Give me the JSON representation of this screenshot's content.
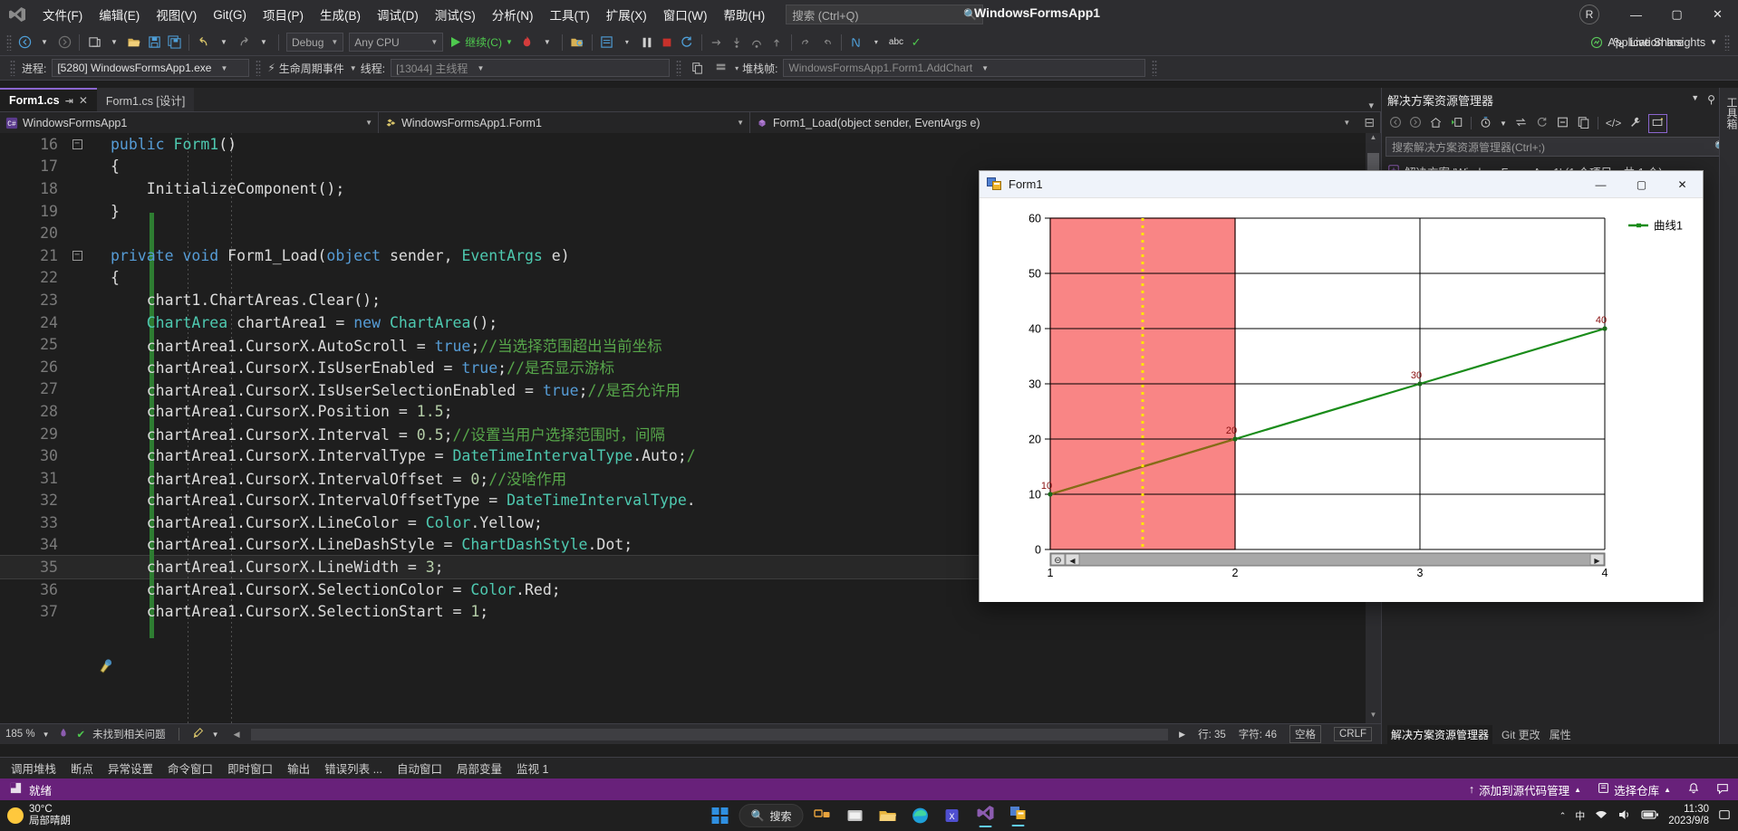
{
  "window": {
    "title": "WindowsFormsApp1",
    "account_initial": "R"
  },
  "menubar": {
    "logo": "vs-logo-icon",
    "items": [
      "文件(F)",
      "编辑(E)",
      "视图(V)",
      "Git(G)",
      "项目(P)",
      "生成(B)",
      "调试(D)",
      "测试(S)",
      "分析(N)",
      "工具(T)",
      "扩展(X)",
      "窗口(W)",
      "帮助(H)"
    ],
    "search_placeholder": "搜索 (Ctrl+Q)",
    "minimize": "—",
    "maximize": "▢",
    "close": "✕"
  },
  "toolbar": {
    "config": "Debug",
    "platform": "Any CPU",
    "run_label": "继续(C)",
    "app_insights": "Application Insights",
    "live_share": "Live Share"
  },
  "debugbar": {
    "process_label": "进程:",
    "process_value": "[5280] WindowsFormsApp1.exe",
    "lifecycle_label": "生命周期事件",
    "thread_label": "线程:",
    "thread_value": "[13044] 主线程",
    "stack_label": "堆栈帧:",
    "stack_value": "WindowsFormsApp1.Form1.AddChart"
  },
  "tabs": [
    {
      "label": "Form1.cs",
      "active": true,
      "pin": "⇥",
      "close": "✕"
    },
    {
      "label": "Form1.cs [设计]",
      "active": false
    }
  ],
  "navbar": {
    "project": "WindowsFormsApp1",
    "project_icon": "csharp-icon",
    "type": "WindowsFormsApp1.Form1",
    "type_icon": "class-icon",
    "member": "Form1_Load(object sender, EventArgs e)",
    "member_icon": "method-icon"
  },
  "code": {
    "start_line": 16,
    "current_line": 35,
    "lines": [
      {
        "n": 16,
        "fold": "−",
        "tokens": [
          [
            "kw",
            "public "
          ],
          [
            "typ",
            "Form1"
          ],
          [
            "plain",
            "()"
          ]
        ]
      },
      {
        "n": 17,
        "tokens": [
          [
            "plain",
            "{"
          ]
        ]
      },
      {
        "n": 18,
        "tokens": [
          [
            "plain",
            "    InitializeComponent();"
          ]
        ]
      },
      {
        "n": 19,
        "tokens": [
          [
            "plain",
            "}"
          ]
        ]
      },
      {
        "n": 20,
        "tokens": [
          [
            "plain",
            ""
          ]
        ]
      },
      {
        "n": 21,
        "fold": "−",
        "tokens": [
          [
            "kw",
            "private void "
          ],
          [
            "plain",
            "Form1_Load("
          ],
          [
            "kw",
            "object"
          ],
          [
            "plain",
            " sender, "
          ],
          [
            "typ",
            "EventArgs"
          ],
          [
            "plain",
            " e)"
          ]
        ]
      },
      {
        "n": 22,
        "tokens": [
          [
            "plain",
            "{"
          ]
        ]
      },
      {
        "n": 23,
        "tokens": [
          [
            "plain",
            "    chart1.ChartAreas.Clear();"
          ]
        ]
      },
      {
        "n": 24,
        "tokens": [
          [
            "plain",
            "    "
          ],
          [
            "typ",
            "ChartArea"
          ],
          [
            "plain",
            " chartArea1 = "
          ],
          [
            "kw",
            "new "
          ],
          [
            "typ",
            "ChartArea"
          ],
          [
            "plain",
            "();"
          ]
        ]
      },
      {
        "n": 25,
        "tokens": [
          [
            "plain",
            "    chartArea1.CursorX.AutoScroll = "
          ],
          [
            "kw",
            "true"
          ],
          [
            "plain",
            ";"
          ],
          [
            "cmt",
            "//当选择范围超出当前坐标"
          ]
        ]
      },
      {
        "n": 26,
        "tokens": [
          [
            "plain",
            "    chartArea1.CursorX.IsUserEnabled = "
          ],
          [
            "kw",
            "true"
          ],
          [
            "plain",
            ";"
          ],
          [
            "cmt",
            "//是否显示游标"
          ]
        ]
      },
      {
        "n": 27,
        "tokens": [
          [
            "plain",
            "    chartArea1.CursorX.IsUserSelectionEnabled = "
          ],
          [
            "kw",
            "true"
          ],
          [
            "plain",
            ";"
          ],
          [
            "cmt",
            "//是否允许用"
          ]
        ]
      },
      {
        "n": 28,
        "tokens": [
          [
            "plain",
            "    chartArea1.CursorX.Position = "
          ],
          [
            "num",
            "1.5"
          ],
          [
            "plain",
            ";"
          ]
        ]
      },
      {
        "n": 29,
        "tokens": [
          [
            "plain",
            "    chartArea1.CursorX.Interval = "
          ],
          [
            "num",
            "0.5"
          ],
          [
            "plain",
            ";"
          ],
          [
            "cmt",
            "//设置当用户选择范围时，间隔"
          ]
        ]
      },
      {
        "n": 30,
        "tokens": [
          [
            "plain",
            "    chartArea1.CursorX.IntervalType = "
          ],
          [
            "typ",
            "DateTimeIntervalType"
          ],
          [
            "plain",
            ".Auto;"
          ],
          [
            "cmt",
            "/"
          ]
        ]
      },
      {
        "n": 31,
        "tokens": [
          [
            "plain",
            "    chartArea1.CursorX.IntervalOffset = "
          ],
          [
            "num",
            "0"
          ],
          [
            "plain",
            ";"
          ],
          [
            "cmt",
            "//没啥作用"
          ]
        ]
      },
      {
        "n": 32,
        "tokens": [
          [
            "plain",
            "    chartArea1.CursorX.IntervalOffsetType = "
          ],
          [
            "typ",
            "DateTimeIntervalType"
          ],
          [
            "plain",
            "."
          ]
        ]
      },
      {
        "n": 33,
        "tokens": [
          [
            "plain",
            "    chartArea1.CursorX.LineColor = "
          ],
          [
            "typ",
            "Color"
          ],
          [
            "plain",
            ".Yellow;"
          ]
        ]
      },
      {
        "n": 34,
        "tokens": [
          [
            "plain",
            "    chartArea1.CursorX.LineDashStyle = "
          ],
          [
            "typ",
            "ChartDashStyle"
          ],
          [
            "plain",
            ".Dot;"
          ]
        ]
      },
      {
        "n": 35,
        "tokens": [
          [
            "plain",
            "    chartArea1.CursorX.LineWidth = "
          ],
          [
            "num",
            "3"
          ],
          [
            "plain",
            ";"
          ]
        ]
      },
      {
        "n": 36,
        "tokens": [
          [
            "plain",
            "    chartArea1.CursorX.SelectionColor = "
          ],
          [
            "typ",
            "Color"
          ],
          [
            "plain",
            ".Red;"
          ]
        ]
      },
      {
        "n": 37,
        "tokens": [
          [
            "plain",
            "    chartArea1.CursorX.SelectionStart = "
          ],
          [
            "num",
            "1"
          ],
          [
            "plain",
            ";"
          ]
        ]
      }
    ]
  },
  "editor_status": {
    "zoom": "185 %",
    "issues": "未找到相关问题",
    "line_label": "行: 35",
    "char_label": "字符: 46",
    "spaces": "空格",
    "eol": "CRLF"
  },
  "solution_explorer": {
    "title": "解决方案资源管理器",
    "search_placeholder": "搜索解决方案资源管理器(Ctrl+;)",
    "root": "解决方案 'WindowsFormsApp1' (1 个项目，共 1 个)",
    "vertical_tab": "工具箱",
    "bottom_tabs": [
      "解决方案资源管理器",
      "Git 更改",
      "属性"
    ]
  },
  "form1": {
    "title": "Form1",
    "minimize": "—",
    "maximize": "▢",
    "close": "✕"
  },
  "chart_data": {
    "type": "line",
    "title": "",
    "xlabel": "",
    "ylabel": "",
    "x": [
      1,
      2,
      3,
      4
    ],
    "values": [
      10,
      20,
      30,
      40
    ],
    "point_labels": [
      "10",
      "20",
      "30",
      "40"
    ],
    "series": [
      {
        "name": "曲线1",
        "values": [
          10,
          20,
          30,
          40
        ],
        "color": "#1a8c1a"
      }
    ],
    "xlim": [
      1,
      4
    ],
    "ylim": [
      0,
      60
    ],
    "ytick_labels": [
      "0",
      "10",
      "20",
      "30",
      "40",
      "50",
      "60"
    ],
    "yticks": [
      0,
      10,
      20,
      30,
      40,
      50,
      60
    ],
    "xtick_labels": [
      "1",
      "2",
      "3",
      "4"
    ],
    "xticks": [
      1,
      2,
      3,
      4
    ],
    "grid": true,
    "legend": {
      "text": "曲线1",
      "position": "right",
      "marker_color": "#1a8c1a"
    },
    "selection": {
      "start": 1,
      "end": 2,
      "color": "#f98585",
      "border": "#a01010"
    },
    "cursor": {
      "position": 1.5,
      "color": "#ffe400",
      "dash": "Dot",
      "width": 3
    },
    "scrollbar": {
      "visible": true,
      "reset_icon": "reset-zoom-icon",
      "left_arrow": "◀",
      "right_arrow": "▶"
    }
  },
  "debug_tabs": [
    "调用堆栈",
    "断点",
    "异常设置",
    "命令窗口",
    "即时窗口",
    "输出",
    "错误列表 ...",
    "自动窗口",
    "局部变量",
    "监视 1"
  ],
  "vs_status": {
    "state": "就绪",
    "source_control": "添加到源代码管理",
    "repo": "选择仓库"
  },
  "taskbar": {
    "temp": "30°C",
    "weather": "局部晴朗",
    "search_placeholder": "搜索",
    "clock_time": "11:30",
    "clock_date": "2023/9/8"
  }
}
